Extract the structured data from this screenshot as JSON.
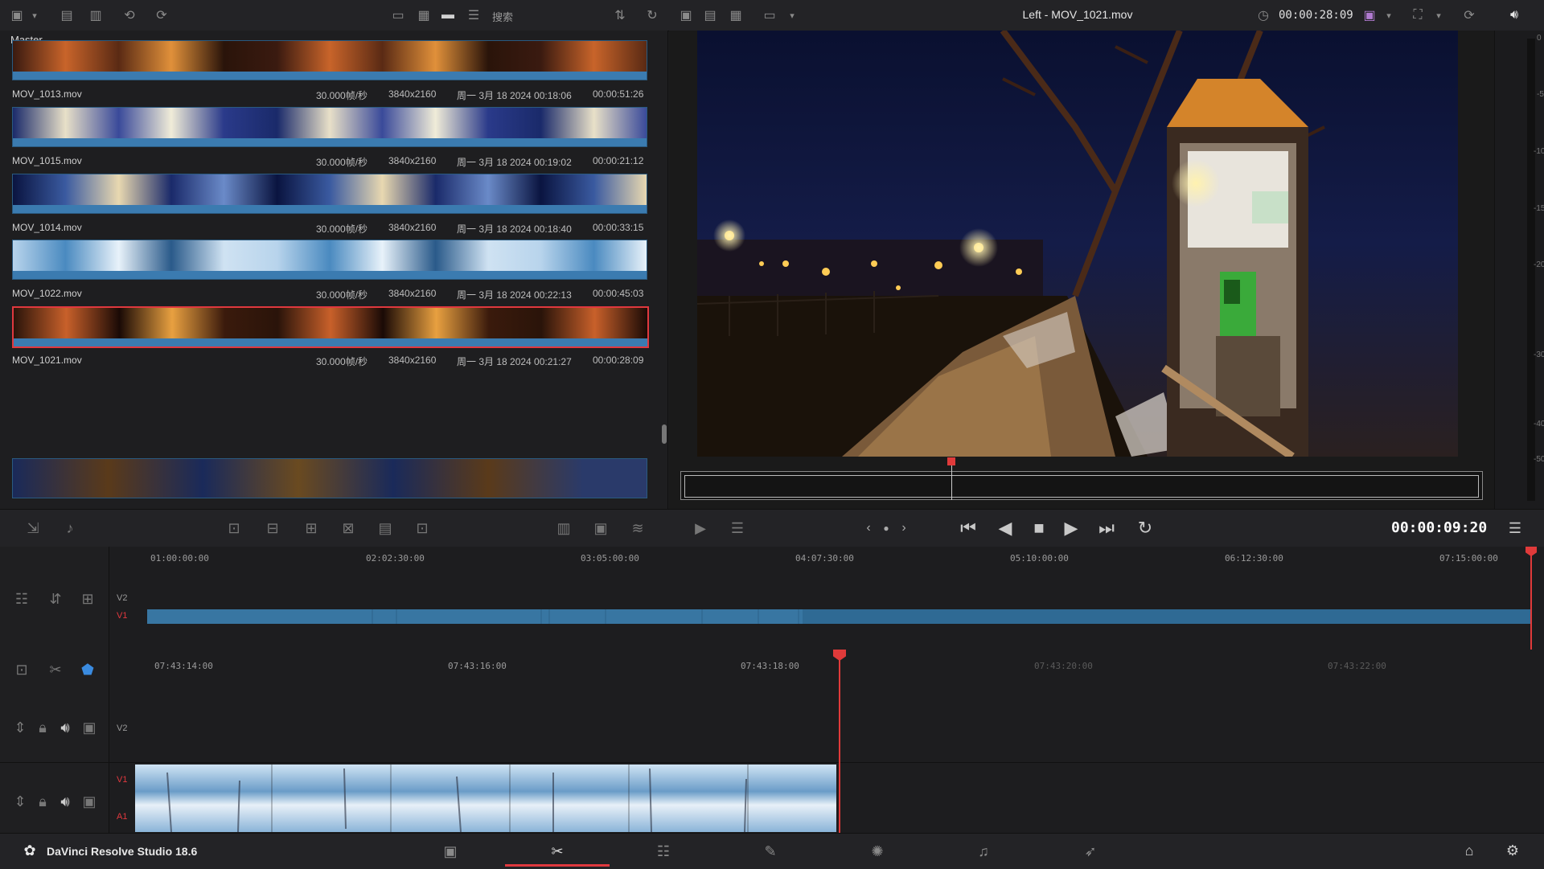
{
  "topbar": {
    "search_placeholder": "搜索",
    "viewer_title": "Left - MOV_1021.mov",
    "source_timecode": "00:00:28:09"
  },
  "media_pool": {
    "bin_name": "Master",
    "clips": [
      {
        "name": "MOV_1013.mov",
        "fps": "30.000帧/秒",
        "resolution": "3840x2160",
        "date": "周一 3月 18 2024 00:18:06",
        "duration": "00:00:51:26",
        "selected": false
      },
      {
        "name": "MOV_1015.mov",
        "fps": "30.000帧/秒",
        "resolution": "3840x2160",
        "date": "周一 3月 18 2024 00:19:02",
        "duration": "00:00:21:12",
        "selected": false
      },
      {
        "name": "MOV_1014.mov",
        "fps": "30.000帧/秒",
        "resolution": "3840x2160",
        "date": "周一 3月 18 2024 00:18:40",
        "duration": "00:00:33:15",
        "selected": false
      },
      {
        "name": "MOV_1022.mov",
        "fps": "30.000帧/秒",
        "resolution": "3840x2160",
        "date": "周一 3月 18 2024 00:22:13",
        "duration": "00:00:45:03",
        "selected": false
      },
      {
        "name": "MOV_1021.mov",
        "fps": "30.000帧/秒",
        "resolution": "3840x2160",
        "date": "周一 3月 18 2024 00:21:27",
        "duration": "00:00:28:09",
        "selected": true
      }
    ]
  },
  "meters": {
    "scale": [
      "0",
      "-5",
      "-10",
      "-15",
      "-20",
      "-30",
      "-40",
      "-50"
    ]
  },
  "transport": {
    "record_timecode": "00:00:09:20"
  },
  "upper_timeline": {
    "ruler": [
      "01:00:00:00",
      "02:02:30:00",
      "03:05:00:00",
      "04:07:30:00",
      "05:10:00:00",
      "06:12:30:00",
      "07:15:00:00"
    ],
    "tracks": [
      "V2",
      "V1"
    ]
  },
  "lower_timeline": {
    "ruler": [
      "07:43:14:00",
      "07:43:16:00",
      "07:43:18:00",
      "07:43:20:00",
      "07:43:22:00"
    ],
    "tracks": {
      "v2": "V2",
      "v1": "V1",
      "a1": "A1"
    }
  },
  "app": {
    "name": "DaVinci Resolve Studio 18.6"
  },
  "colors": {
    "accent_red": "#e0383e",
    "clip_blue": "#3b7bb0",
    "background": "#1c1c1e"
  }
}
